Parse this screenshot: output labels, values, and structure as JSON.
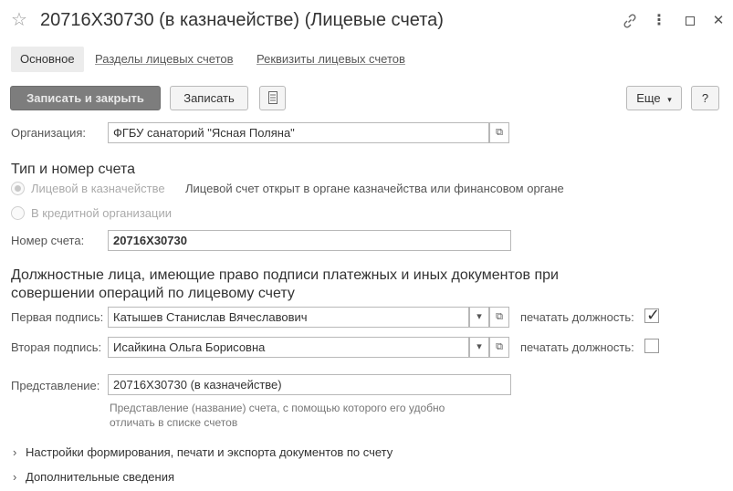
{
  "window": {
    "title": "20716X30730 (в казначействе) (Лицевые счета)"
  },
  "tabs": [
    {
      "label": "Основное",
      "active": true
    },
    {
      "label": "Разделы лицевых счетов",
      "active": false
    },
    {
      "label": "Реквизиты лицевых счетов",
      "active": false
    }
  ],
  "toolbar": {
    "save_close_label": "Записать и закрыть",
    "save_label": "Записать",
    "more_label": "Еще",
    "help_label": "?"
  },
  "organization": {
    "label": "Организация:",
    "value": "ФГБУ санаторий \"Ясная Поляна\""
  },
  "account_type": {
    "section_title": "Тип и номер счета",
    "option_treasury": "Лицевой в казначействе",
    "option_treasury_desc": "Лицевой счет открыт в органе казначейства или финансовом органе",
    "option_credit": "В кредитной организации",
    "selected": "treasury",
    "number_label": "Номер счета:",
    "number_value": "20716X30730"
  },
  "signatories": {
    "section_title_line1": "Должностные лица, имеющие право подписи платежных и иных документов при",
    "section_title_line2": "совершении операций по лицевому счету",
    "first_label": "Первая подпись:",
    "first_value": "Катышев Станислав Вячеславович",
    "first_print_label": "печатать должность:",
    "first_print_checked": true,
    "second_label": "Вторая подпись:",
    "second_value": "Исайкина Ольга Борисовна",
    "second_print_label": "печатать должность:",
    "second_print_checked": false
  },
  "representation": {
    "label": "Представление:",
    "value": "20716X30730 (в казначействе)",
    "hint_line1": "Представление (название) счета, с помощью которого его удобно",
    "hint_line2": "отличать в списке счетов"
  },
  "expanders": {
    "settings_label": "Настройки формирования, печати и экспорта документов по счету",
    "extra_label": "Дополнительные сведения"
  },
  "icons": {
    "star": "☆",
    "link": "🔗",
    "menu": "⋮",
    "maximize": "☐",
    "close": "✕",
    "list": "☰",
    "open": "⧉",
    "dropdown": "▾",
    "chevron": "›"
  }
}
